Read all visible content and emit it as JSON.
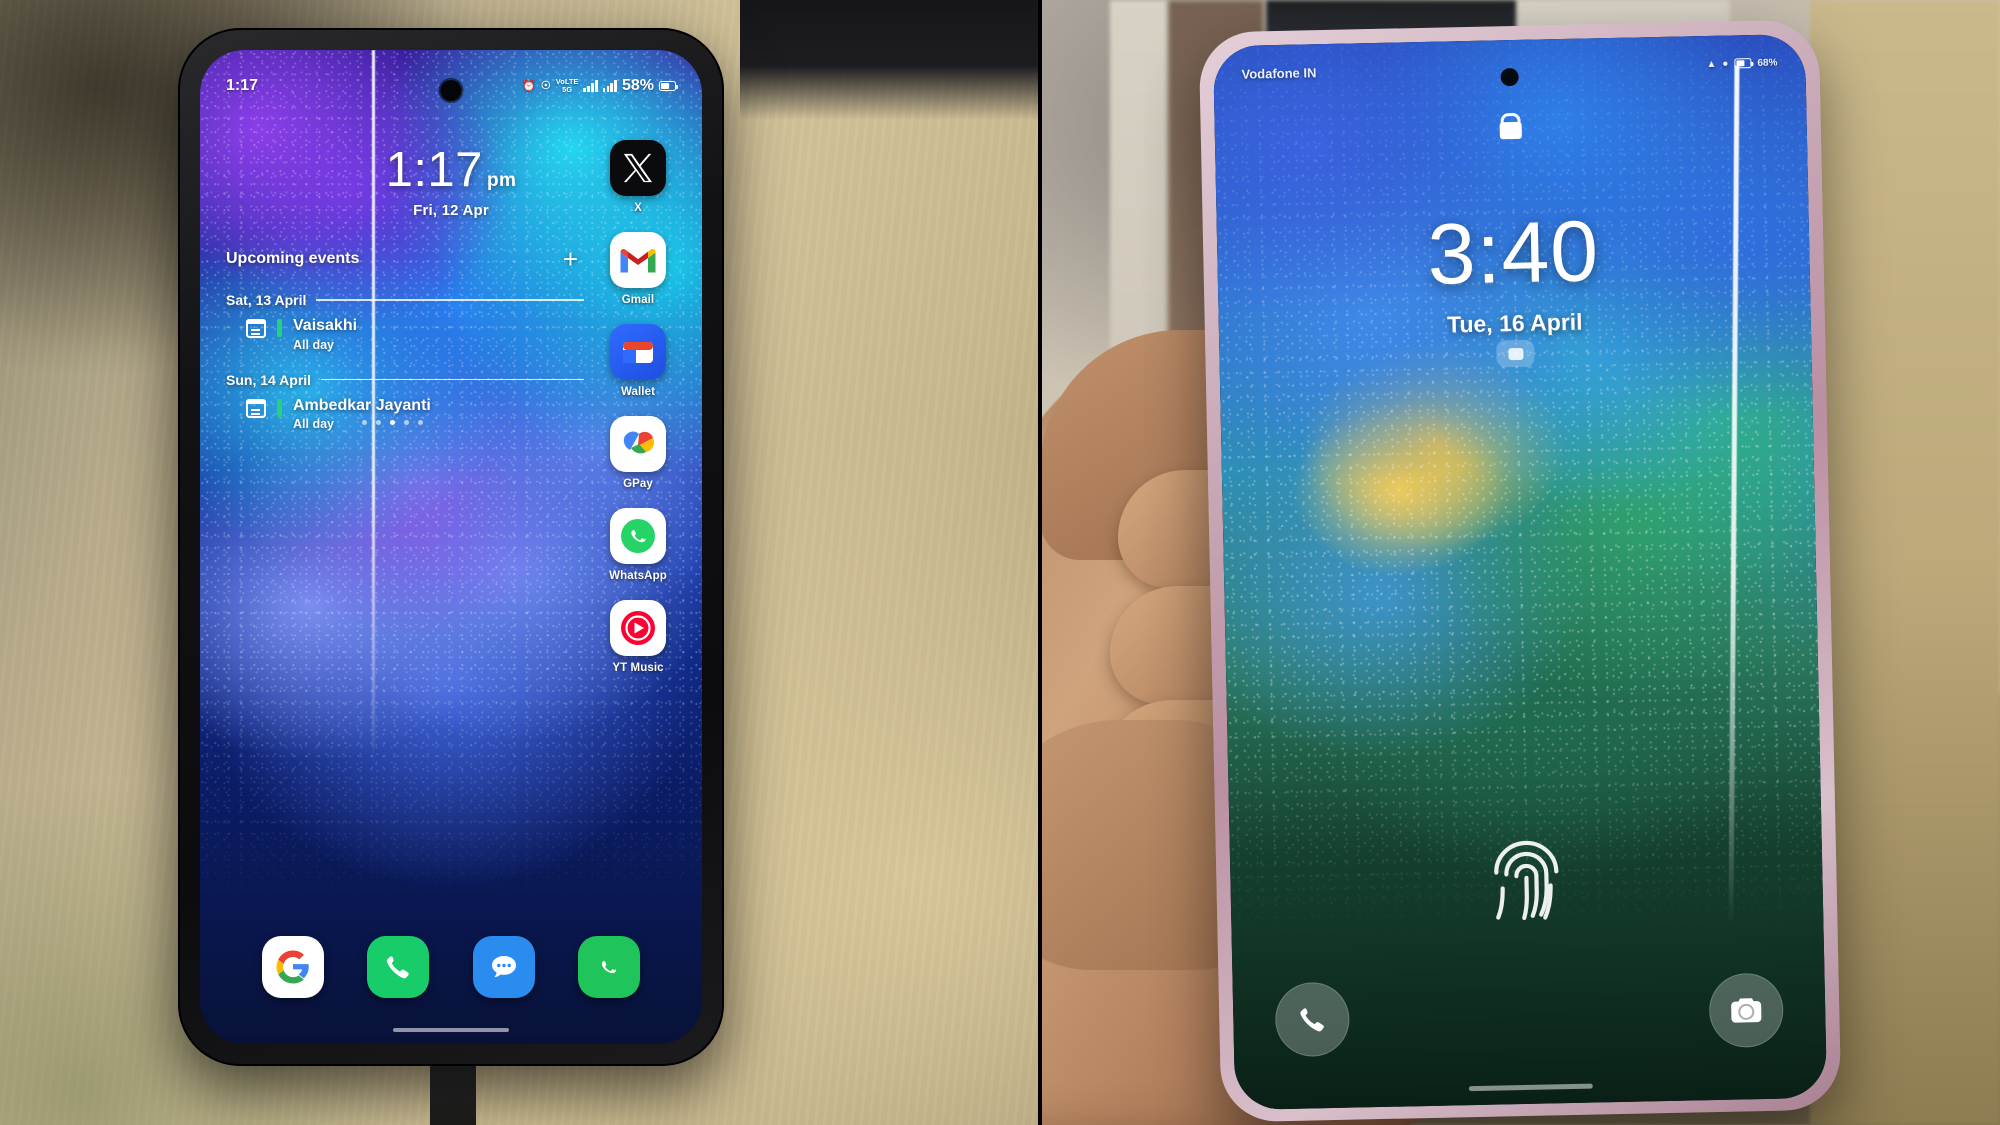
{
  "left_phone": {
    "status_bar": {
      "time": "1:17",
      "icons": [
        "alarm-icon",
        "wifi-calling-icon",
        "volte-5g-icon",
        "signal-bars-sim1",
        "signal-bars-sim2"
      ],
      "vo5g_label": "VoLTE",
      "net_label": "5G",
      "battery_percent": "58%"
    },
    "clock_widget": {
      "time": "1:17",
      "meridiem": "pm",
      "date": "Fri, 12 Apr"
    },
    "calendar_widget": {
      "title": "Upcoming events",
      "add_label": "+",
      "groups": [
        {
          "date_label": "Sat, 13 April",
          "events": [
            {
              "name": "Vaisakhi",
              "time": "All day",
              "color": "#26d07c"
            }
          ]
        },
        {
          "date_label": "Sun, 14 April",
          "events": [
            {
              "name": "Ambedkar Jayanti",
              "time": "All day",
              "color": "#26d07c"
            }
          ]
        }
      ]
    },
    "app_column": [
      {
        "label": "X",
        "icon": "x-app-icon",
        "glyph": "✕"
      },
      {
        "label": "Gmail",
        "icon": "gmail-icon",
        "glyph": "M"
      },
      {
        "label": "Wallet",
        "icon": "wallet-icon",
        "glyph": ""
      },
      {
        "label": "GPay",
        "icon": "gpay-icon",
        "glyph": ""
      },
      {
        "label": "WhatsApp",
        "icon": "whatsapp-icon",
        "glyph": ""
      },
      {
        "label": "YT Music",
        "icon": "yt-music-icon",
        "glyph": ""
      }
    ],
    "dock": [
      {
        "label": "Google",
        "icon": "google-icon",
        "glyph": "G"
      },
      {
        "label": "Phone",
        "icon": "phone-icon",
        "glyph": "✆"
      },
      {
        "label": "Messages",
        "icon": "messages-icon",
        "glyph": ""
      },
      {
        "label": "WhatsApp Business",
        "icon": "whatsapp-business-icon",
        "glyph": "B"
      }
    ],
    "page_dots": 5,
    "active_dot": 2
  },
  "right_phone": {
    "status_bar": {
      "carrier": "Vodafone IN",
      "icons": [
        "wifi-icon",
        "signal-icon",
        "battery-icon"
      ],
      "battery_percent": "68%"
    },
    "lock_icon": "lock-icon",
    "clock": {
      "time": "3:40",
      "date": "Tue, 16 April"
    },
    "notification_pill": "notification-icon",
    "fingerprint": "fingerprint-icon",
    "shortcuts": [
      {
        "icon": "phone-shortcut-icon",
        "label": "Phone"
      },
      {
        "icon": "camera-shortcut-icon",
        "label": "Camera"
      }
    ]
  },
  "colors": {
    "accent_green": "#26d07c",
    "google_blue": "#2b8cf0",
    "whatsapp_green": "#19cc6a",
    "youtube_red": "#e8202a"
  }
}
